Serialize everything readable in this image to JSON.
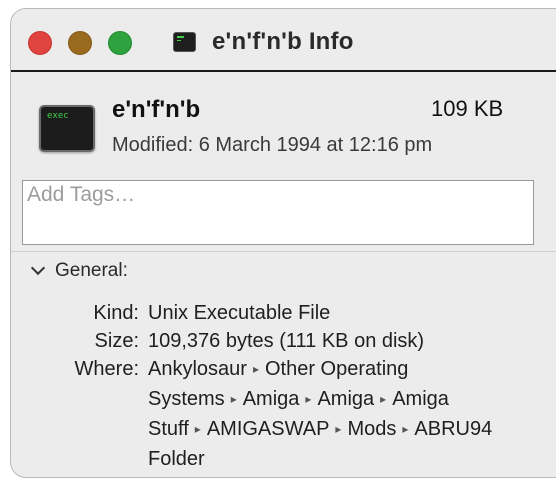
{
  "window": {
    "title": "e'n'f'n'b Info"
  },
  "header": {
    "file_icon_label": "exec",
    "file_name": "e'n'f'n'b",
    "file_size": "109 KB",
    "modified": "Modified: 6 March 1994 at 12:16 pm"
  },
  "tags": {
    "placeholder": "Add Tags…",
    "value": ""
  },
  "general": {
    "title": "General:",
    "expanded": true,
    "kind_label": "Kind:",
    "kind": "Unix Executable File",
    "size_label": "Size:",
    "size": "109,376 bytes (111 KB on disk)",
    "where_label": "Where:",
    "path_separator": "▸",
    "where_path": [
      "Ankylosaur",
      "Other Operating Systems",
      "Amiga",
      "Amiga",
      "Amiga Stuff",
      "AMIGASWAP",
      "Mods",
      "ABRU94 Folder"
    ]
  },
  "colors": {
    "close": "#e0443e",
    "minimize": "#9a6b1f",
    "zoom": "#2ea23e",
    "window_bg": "#ececec",
    "terminal_green": "#3fd14a"
  },
  "icons": {
    "title_icon": "terminal-exec-icon",
    "file_icon": "exec-file-icon",
    "disclosure": "chevron-down-icon"
  }
}
